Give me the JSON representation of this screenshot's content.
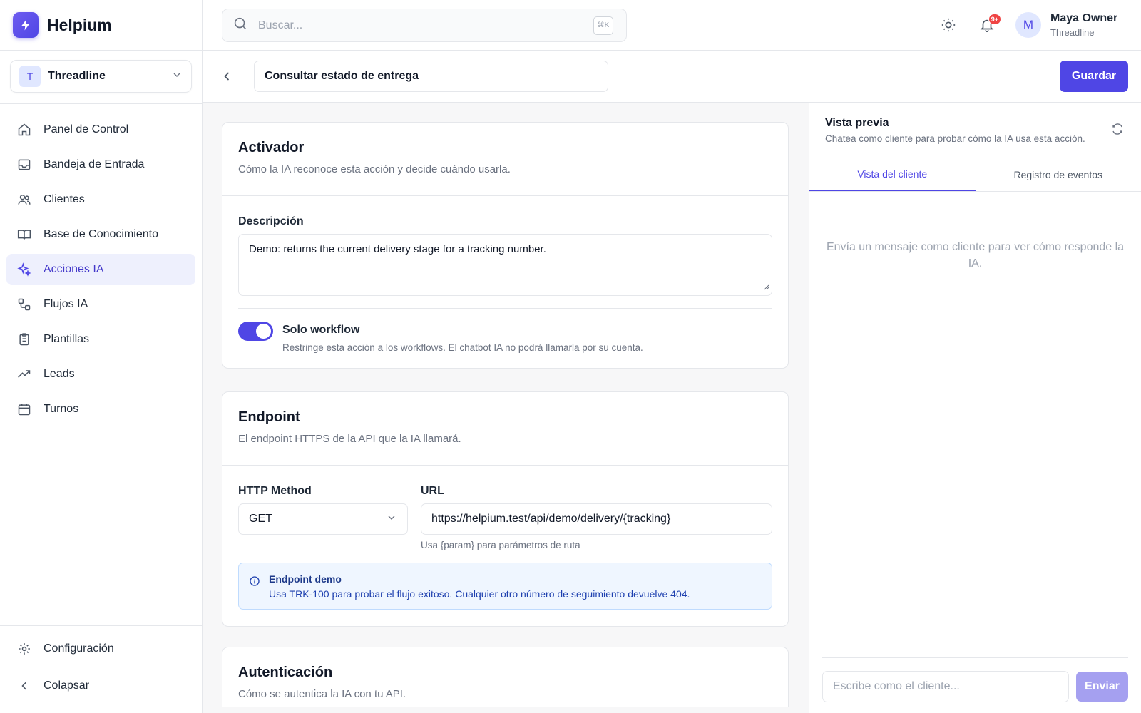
{
  "app": {
    "name": "Helpium",
    "accent": "#4f46e5"
  },
  "workspace": {
    "initial": "T",
    "name": "Threadline"
  },
  "nav": {
    "items": [
      {
        "label": "Panel de Control",
        "icon": "home-icon"
      },
      {
        "label": "Bandeja de Entrada",
        "icon": "inbox-icon"
      },
      {
        "label": "Clientes",
        "icon": "users-icon"
      },
      {
        "label": "Base de Conocimiento",
        "icon": "book-icon"
      },
      {
        "label": "Acciones IA",
        "icon": "sparkles-icon",
        "active": true
      },
      {
        "label": "Flujos IA",
        "icon": "workflow-icon"
      },
      {
        "label": "Plantillas",
        "icon": "clipboard-icon"
      },
      {
        "label": "Leads",
        "icon": "trending-up-icon"
      },
      {
        "label": "Turnos",
        "icon": "calendar-icon"
      }
    ],
    "settings": "Configuración",
    "collapse": "Colapsar"
  },
  "topbar": {
    "search_placeholder": "Buscar...",
    "search_shortcut": "⌘K",
    "notifications_badge": "9+",
    "user": {
      "initial": "M",
      "name": "Maya Owner",
      "org": "Threadline"
    }
  },
  "editor": {
    "title": "Consultar estado de entrega",
    "save_label": "Guardar"
  },
  "trigger": {
    "title": "Activador",
    "subtitle": "Cómo la IA reconoce esta acción y decide cuándo usarla.",
    "description_label": "Descripción",
    "description_value": "Demo: returns the current delivery stage for a tracking number.",
    "toggle_title": "Solo workflow",
    "toggle_desc": "Restringe esta acción a los workflows. El chatbot IA no podrá llamarla por su cuenta.",
    "toggle_on": true
  },
  "endpoint": {
    "title": "Endpoint",
    "subtitle": "El endpoint HTTPS de la API que la IA llamará.",
    "method_label": "HTTP Method",
    "method_value": "GET",
    "url_label": "URL",
    "url_value": "https://helpium.test/api/demo/delivery/{tracking}",
    "url_hint": "Usa {param} para parámetros de ruta",
    "info_title": "Endpoint demo",
    "info_desc": "Usa TRK-100 para probar el flujo exitoso. Cualquier otro número de seguimiento devuelve 404."
  },
  "auth": {
    "title": "Autenticación",
    "subtitle": "Cómo se autentica la IA con tu API."
  },
  "preview": {
    "title": "Vista previa",
    "subtitle": "Chatea como cliente para probar cómo la IA usa esta acción.",
    "tabs": [
      "Vista del cliente",
      "Registro de eventos"
    ],
    "empty": "Envía un mensaje como cliente para ver cómo responde la IA.",
    "input_placeholder": "Escribe como el cliente...",
    "send_label": "Enviar"
  }
}
